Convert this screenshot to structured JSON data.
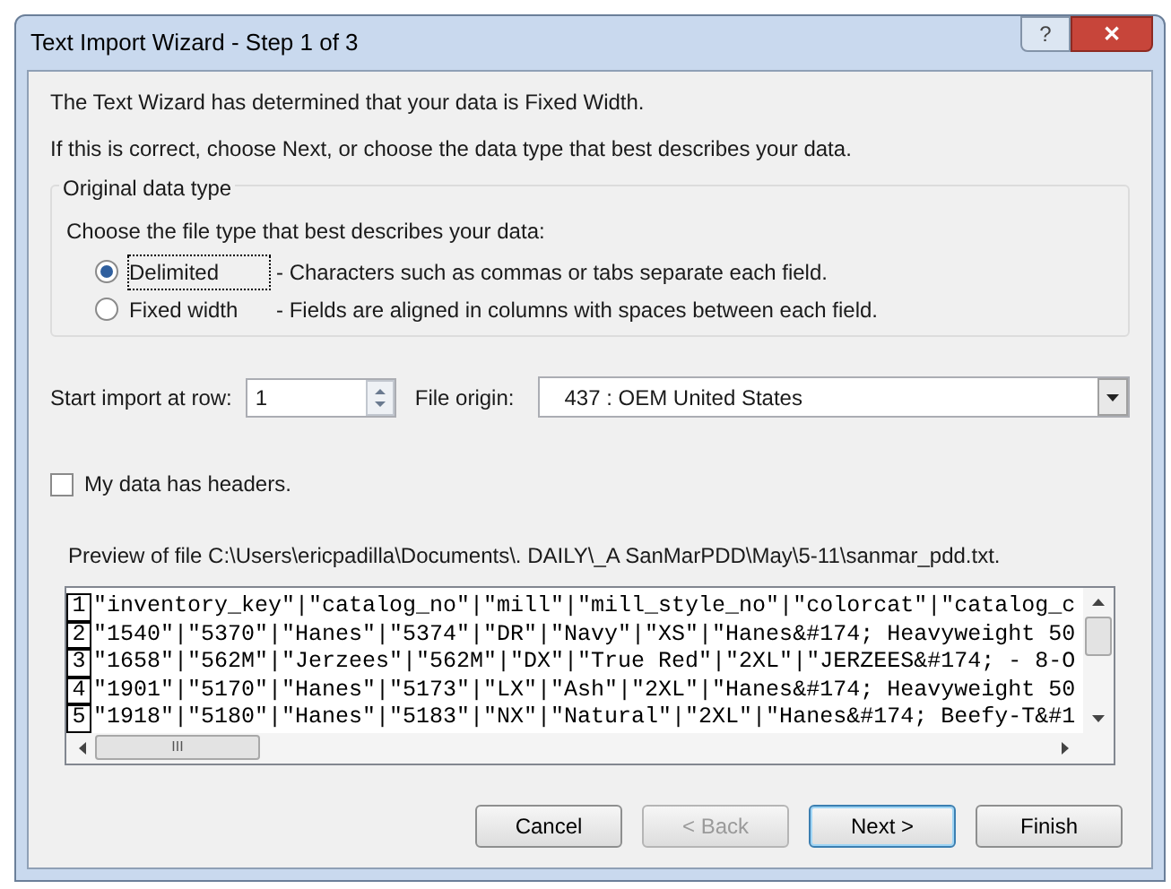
{
  "window": {
    "title": "Text Import Wizard - Step 1 of 3",
    "help_button": "?",
    "close_button": "✕"
  },
  "intro": [
    "The Text Wizard has determined that your data is Fixed Width.",
    "If this is correct, choose Next, or choose the data type that best describes your data."
  ],
  "data_type": {
    "legend": "Original data type",
    "prompt": "Choose the file type that best describes your data:",
    "options": [
      {
        "label": "Delimited",
        "description": "- Characters such as commas or tabs separate each field.",
        "selected": true
      },
      {
        "label": "Fixed width",
        "description": "- Fields are aligned in columns with spaces between each field.",
        "selected": false
      }
    ]
  },
  "start_row": {
    "label": "Start import at row:",
    "value": "1"
  },
  "file_origin": {
    "label": "File origin:",
    "value": "437 : OEM United States"
  },
  "headers": {
    "label": "My data has headers.",
    "checked": false
  },
  "preview": {
    "label": "Preview of file C:\\Users\\ericpadilla\\Documents\\. DAILY\\_A SanMarPDD\\May\\5-11\\sanmar_pdd.txt.",
    "rows": [
      {
        "number": "1",
        "text": "\"inventory_key\"|\"catalog_no\"|\"mill\"|\"mill_style_no\"|\"colorcat\"|\"catalog_c"
      },
      {
        "number": "2",
        "text": "\"1540\"|\"5370\"|\"Hanes\"|\"5374\"|\"DR\"|\"Navy\"|\"XS\"|\"Hanes&#174; Heavyweight 50"
      },
      {
        "number": "3",
        "text": "\"1658\"|\"562M\"|\"Jerzees\"|\"562M\"|\"DX\"|\"True Red\"|\"2XL\"|\"JERZEES&#174; - 8-O"
      },
      {
        "number": "4",
        "text": "\"1901\"|\"5170\"|\"Hanes\"|\"5173\"|\"LX\"|\"Ash\"|\"2XL\"|\"Hanes&#174; Heavyweight 50"
      },
      {
        "number": "5",
        "text": "\"1918\"|\"5180\"|\"Hanes\"|\"5183\"|\"NX\"|\"Natural\"|\"2XL\"|\"Hanes&#174; Beefy-T&#1"
      }
    ],
    "hscroll_grip": "III"
  },
  "buttons": [
    {
      "label": "Cancel",
      "disabled": false,
      "default": false
    },
    {
      "label": "< Back",
      "disabled": true,
      "default": false
    },
    {
      "label": "Next >",
      "disabled": false,
      "default": true
    },
    {
      "label": "Finish",
      "disabled": false,
      "default": false
    }
  ]
}
